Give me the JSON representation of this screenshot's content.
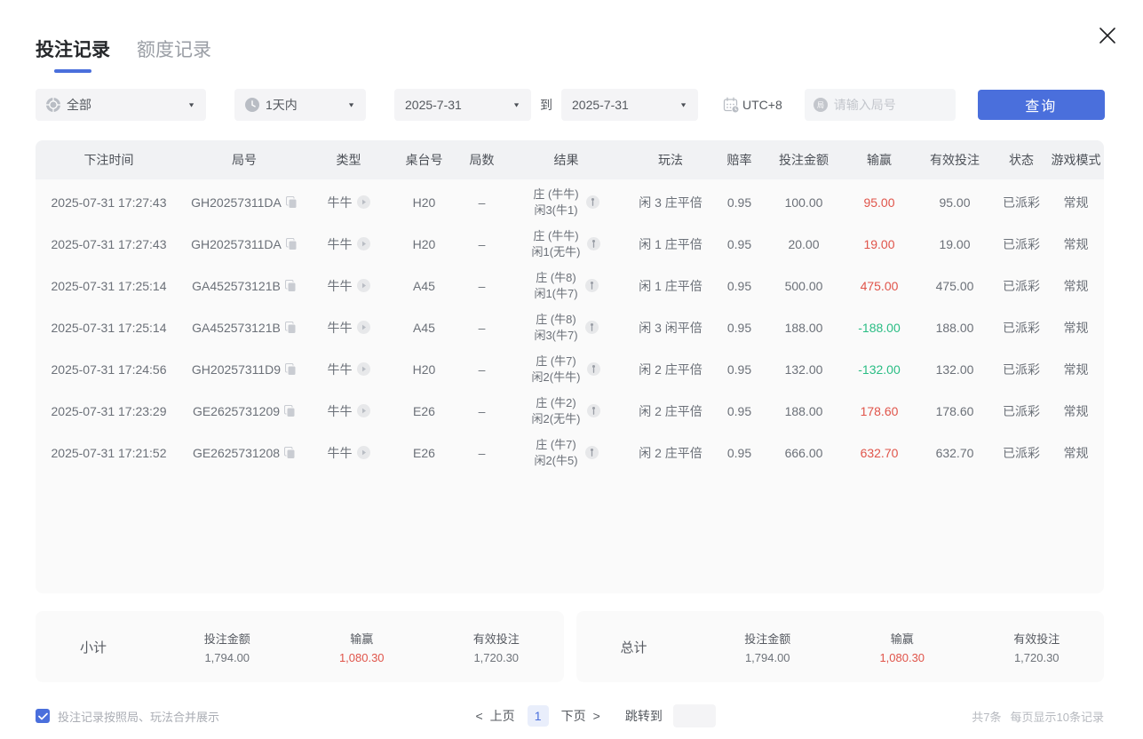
{
  "colors": {
    "accent": "#4a6fdc",
    "profit_red": "#e0544a",
    "loss_green": "#2abd84"
  },
  "tabs": [
    {
      "label": "投注记录"
    },
    {
      "label": "额度记录"
    }
  ],
  "filters": {
    "game_type": "全部",
    "time_range": "1天内",
    "date_from": "2025-7-31",
    "to_label": "到",
    "date_to": "2025-7-31",
    "timezone": "UTC+8",
    "round_placeholder": "请输入局号",
    "query_label": "查询"
  },
  "table": {
    "headers": [
      "下注时间",
      "局号",
      "类型",
      "桌台号",
      "局数",
      "结果",
      "玩法",
      "赔率",
      "投注金额",
      "输赢",
      "有效投注",
      "状态",
      "游戏模式"
    ],
    "rows": [
      {
        "time": "2025-07-31 17:27:43",
        "round_id": "GH20257311DA",
        "game_type": "牛牛",
        "table_no": "H20",
        "round_count": "–",
        "result_banker": "庄 (牛牛)",
        "result_player": "闲3(牛1)",
        "play": "闲 3 庄平倍",
        "odds": "0.95",
        "bet_amount": "100.00",
        "win_loss": "95.00",
        "win_loss_positive": true,
        "valid_bet": "95.00",
        "status": "已派彩",
        "mode": "常规"
      },
      {
        "time": "2025-07-31 17:27:43",
        "round_id": "GH20257311DA",
        "game_type": "牛牛",
        "table_no": "H20",
        "round_count": "–",
        "result_banker": "庄 (牛牛)",
        "result_player": "闲1(无牛)",
        "play": "闲 1 庄平倍",
        "odds": "0.95",
        "bet_amount": "20.00",
        "win_loss": "19.00",
        "win_loss_positive": true,
        "valid_bet": "19.00",
        "status": "已派彩",
        "mode": "常规"
      },
      {
        "time": "2025-07-31 17:25:14",
        "round_id": "GA452573121B",
        "game_type": "牛牛",
        "table_no": "A45",
        "round_count": "–",
        "result_banker": "庄 (牛8)",
        "result_player": "闲1(牛7)",
        "play": "闲 1 庄平倍",
        "odds": "0.95",
        "bet_amount": "500.00",
        "win_loss": "475.00",
        "win_loss_positive": true,
        "valid_bet": "475.00",
        "status": "已派彩",
        "mode": "常规"
      },
      {
        "time": "2025-07-31 17:25:14",
        "round_id": "GA452573121B",
        "game_type": "牛牛",
        "table_no": "A45",
        "round_count": "–",
        "result_banker": "庄 (牛8)",
        "result_player": "闲3(牛7)",
        "play": "闲 3 闲平倍",
        "odds": "0.95",
        "bet_amount": "188.00",
        "win_loss": "-188.00",
        "win_loss_positive": false,
        "valid_bet": "188.00",
        "status": "已派彩",
        "mode": "常规"
      },
      {
        "time": "2025-07-31 17:24:56",
        "round_id": "GH20257311D9",
        "game_type": "牛牛",
        "table_no": "H20",
        "round_count": "–",
        "result_banker": "庄 (牛7)",
        "result_player": "闲2(牛牛)",
        "play": "闲 2 庄平倍",
        "odds": "0.95",
        "bet_amount": "132.00",
        "win_loss": "-132.00",
        "win_loss_positive": false,
        "valid_bet": "132.00",
        "status": "已派彩",
        "mode": "常规"
      },
      {
        "time": "2025-07-31 17:23:29",
        "round_id": "GE2625731209",
        "game_type": "牛牛",
        "table_no": "E26",
        "round_count": "–",
        "result_banker": "庄 (牛2)",
        "result_player": "闲2(无牛)",
        "play": "闲 2 庄平倍",
        "odds": "0.95",
        "bet_amount": "188.00",
        "win_loss": "178.60",
        "win_loss_positive": true,
        "valid_bet": "178.60",
        "status": "已派彩",
        "mode": "常规"
      },
      {
        "time": "2025-07-31 17:21:52",
        "round_id": "GE2625731208",
        "game_type": "牛牛",
        "table_no": "E26",
        "round_count": "–",
        "result_banker": "庄 (牛7)",
        "result_player": "闲2(牛5)",
        "play": "闲 2 庄平倍",
        "odds": "0.95",
        "bet_amount": "666.00",
        "win_loss": "632.70",
        "win_loss_positive": true,
        "valid_bet": "632.70",
        "status": "已派彩",
        "mode": "常规"
      }
    ]
  },
  "summary": {
    "col_labels": {
      "bet_amount": "投注金额",
      "winloss": "输赢",
      "valid_bet": "有效投注"
    },
    "subtotal": {
      "label": "小计",
      "bet_amount": "1,794.00",
      "winloss": "1,080.30",
      "valid_bet": "1,720.30"
    },
    "total": {
      "label": "总计",
      "bet_amount": "1,794.00",
      "winloss": "1,080.30",
      "valid_bet": "1,720.30"
    }
  },
  "footer": {
    "merge_label": "投注记录按照局、玩法合并展示",
    "prev_arrow": "<",
    "prev_label": "上页",
    "current_page": "1",
    "next_label": "下页",
    "next_arrow": ">",
    "jump_label": "跳转到",
    "total_count": "共7条",
    "page_size": "每页显示10条记录"
  }
}
